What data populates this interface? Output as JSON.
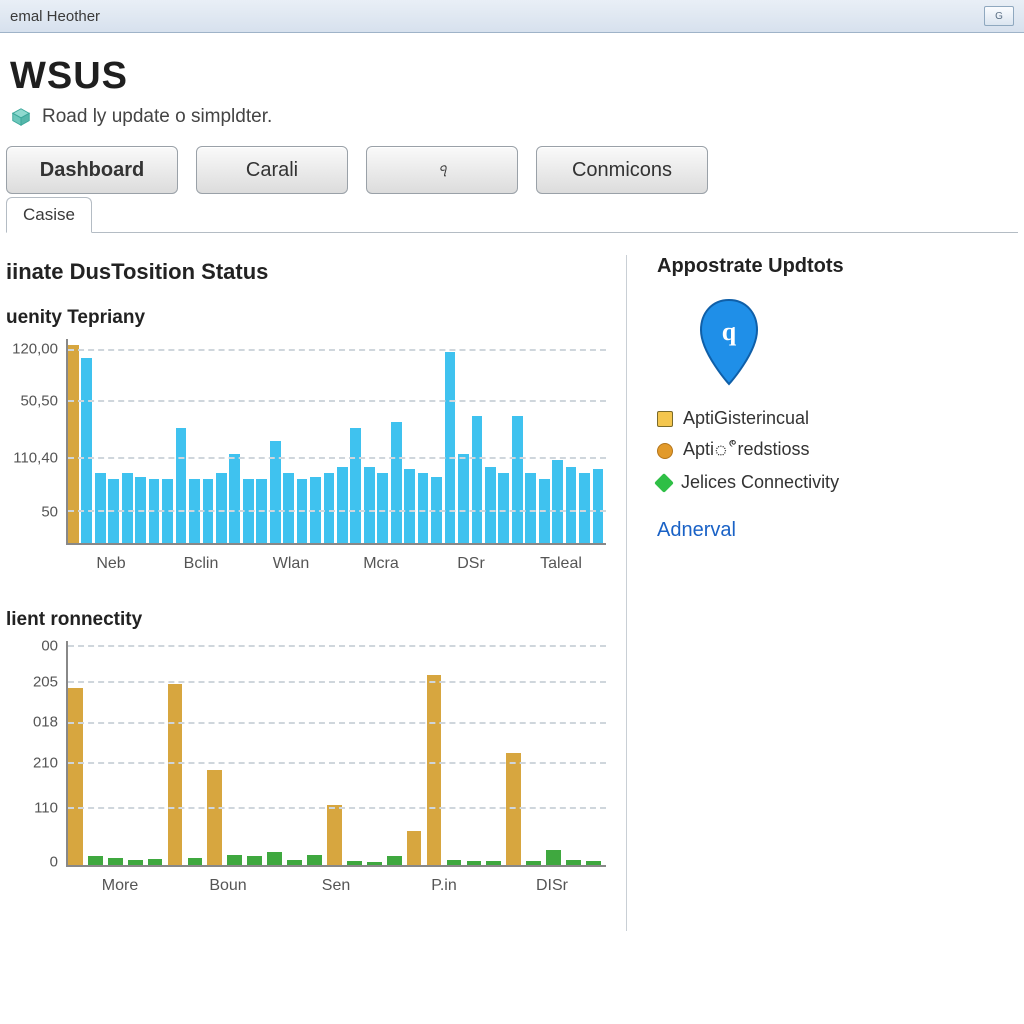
{
  "titlebar": {
    "text": "emal Heother",
    "min_label": "G"
  },
  "header": {
    "app_title": "WSUS",
    "subtitle": "Road ly update o simpldter."
  },
  "toolbar": {
    "dashboard": "Dashboard",
    "carali": "Carali",
    "iconbtn_glyph": "ঀ",
    "conmicons": "Conmicons"
  },
  "tabs": {
    "active": "Casise"
  },
  "main": {
    "status_title": "iinate DusTosition Status",
    "chart1_title": "uenity Tepriany",
    "chart2_title": "lient ronnectity"
  },
  "right": {
    "title": "Appostrate Updtots",
    "legend": [
      "AptiGisterincual",
      "Aptiீredstioss",
      "Jelices Connectivity"
    ],
    "link": "Adnerval"
  },
  "colors": {
    "bar_blue": "#3fc2ef",
    "bar_gold": "#d7a63f",
    "bar_green": "#3fa83f"
  },
  "chart_data": [
    {
      "type": "bar",
      "title": "uenity Tepriany",
      "xlabel": "",
      "ylabel": "",
      "y_ticks": [
        "120,00",
        "50,50",
        "110,40",
        "50"
      ],
      "ylim": [
        0,
        160
      ],
      "categories": [
        "Neb",
        "Bclin",
        "Wlan",
        "Mcra",
        "DSr",
        "Taleal"
      ],
      "values": [
        155,
        145,
        55,
        50,
        55,
        52,
        50,
        50,
        90,
        50,
        50,
        55,
        70,
        50,
        50,
        80,
        55,
        50,
        52,
        55,
        60,
        90,
        60,
        55,
        95,
        58,
        55,
        52,
        150,
        70,
        100,
        60,
        55,
        100,
        55,
        50,
        65,
        60,
        55,
        58
      ],
      "series": [
        {
          "name": "main",
          "color": "#3fc2ef"
        },
        {
          "name": "highlight",
          "color": "#d7a63f",
          "indices": [
            0
          ]
        }
      ]
    },
    {
      "type": "bar",
      "title": "lient ronnectity",
      "xlabel": "",
      "ylabel": "",
      "y_ticks": [
        "00",
        "205",
        "018",
        "210",
        "110",
        "0"
      ],
      "ylim": [
        0,
        260
      ],
      "categories": [
        "More",
        "Boun",
        "Sen",
        "P.in",
        "DISr"
      ],
      "series": [
        {
          "name": "gold",
          "color": "#d7a63f",
          "x": [
            0,
            5,
            7,
            13,
            17,
            18,
            22
          ],
          "values": [
            205,
            210,
            110,
            70,
            40,
            220,
            130
          ]
        },
        {
          "name": "green",
          "color": "#3fa83f",
          "x": [
            1,
            2,
            3,
            4,
            6,
            8,
            9,
            10,
            11,
            12,
            14,
            15,
            16,
            19,
            20,
            21,
            23,
            24,
            25,
            26
          ],
          "values": [
            10,
            8,
            6,
            7,
            8,
            12,
            10,
            15,
            6,
            12,
            5,
            4,
            10,
            6,
            5,
            5,
            5,
            18,
            6,
            5
          ]
        }
      ]
    }
  ]
}
